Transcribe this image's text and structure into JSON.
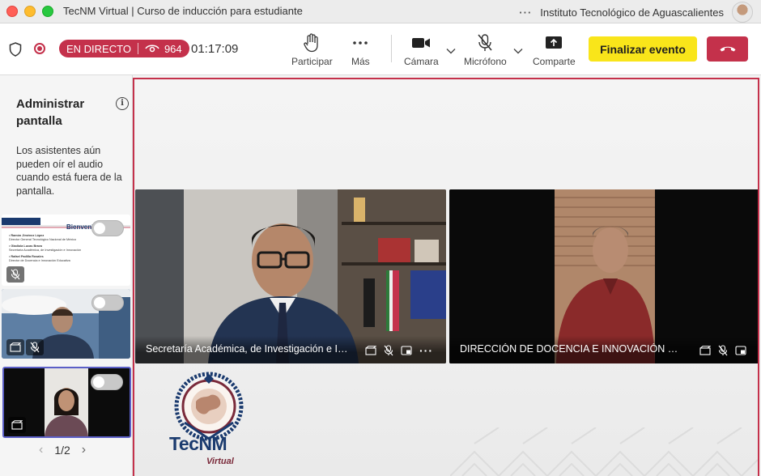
{
  "window": {
    "title": "TecNM Virtual | Curso de inducción para estudiante",
    "organization": "Instituto Tecnológico de Aguascalientes",
    "more_label": "···"
  },
  "toolbar": {
    "live_label": "EN DIRECTO",
    "viewer_count": "964",
    "elapsed_time": "01:17:09",
    "raise_hand_label": "Participar",
    "more_label": "Más",
    "camera_label": "Cámara",
    "mic_label": "Micrófono",
    "share_label": "Comparte",
    "end_event_label": "Finalizar evento"
  },
  "left_panel": {
    "title": "Administrar pantalla",
    "description": "Los asistentes aún pueden oír el audio cuando está fuera de la pantalla.",
    "slide_heading": "Bienvenid",
    "slide_lines": [
      "• Ramón Jiménez López",
      "Director General Tecnológico Nacional de México",
      "• Gladiola Lucas Bravo",
      "Secretaria Académica, de Investigación e Innovación",
      "• Rafael Padilla Rosales",
      "Director de Docencia e Innovación Educativa"
    ],
    "pagination": "1/2"
  },
  "stage": {
    "participants": [
      {
        "name": "Secretaría Académica, de Investigación e Innovación"
      },
      {
        "name": "DIRECCIÓN DE DOCENCIA E INNOVACIÓN EDUCATIVA"
      }
    ],
    "logo_text": "TecNM",
    "logo_sub": "Virtual"
  },
  "colors": {
    "live_red": "#c4314b",
    "end_event_yellow": "#f9e51a",
    "selection_purple": "#5b5fc7",
    "logo_blue": "#1a3a6e"
  }
}
